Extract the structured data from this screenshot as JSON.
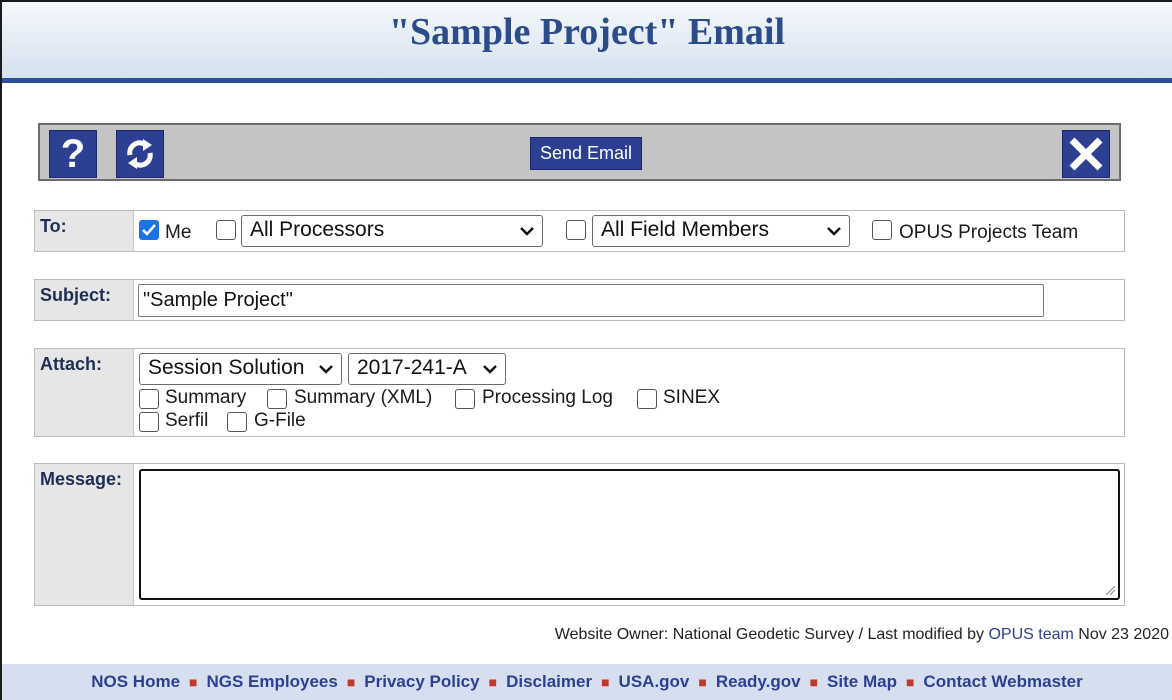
{
  "header": {
    "title": "\"Sample Project\" Email"
  },
  "toolbar": {
    "help_icon": "help-icon",
    "refresh_icon": "refresh-icon",
    "send_label": "Send Email",
    "close_icon": "close-icon"
  },
  "to": {
    "label": "To:",
    "me_label": "Me",
    "me_checked": true,
    "processors_checked": false,
    "processors_select": "All Processors",
    "field_members_checked": false,
    "field_members_select": "All Field Members",
    "opus_team_checked": false,
    "opus_team_label": "OPUS Projects Team"
  },
  "subject": {
    "label": "Subject:",
    "value": "\"Sample Project\""
  },
  "attach": {
    "label": "Attach:",
    "solution_select": "Session Solution",
    "session_select": "2017-241-A",
    "options": [
      {
        "label": "Summary",
        "checked": false
      },
      {
        "label": "Summary (XML)",
        "checked": false
      },
      {
        "label": "Processing Log",
        "checked": false
      },
      {
        "label": "SINEX",
        "checked": false
      },
      {
        "label": "Serfil",
        "checked": false
      },
      {
        "label": "G-File",
        "checked": false
      }
    ]
  },
  "message": {
    "label": "Message:",
    "value": ""
  },
  "footer": {
    "owner_prefix": "Website Owner: National Geodetic Survey  /  Last modified by ",
    "owner_link": "OPUS team",
    "owner_date": " Nov 23 2020",
    "links": [
      "NOS Home",
      "NGS Employees",
      "Privacy Policy",
      "Disclaimer",
      "USA.gov",
      "Ready.gov",
      "Site Map",
      "Contact Webmaster"
    ]
  },
  "colors": {
    "accent": "#2d3f91",
    "separator": "#c0392b",
    "checkbox_checked": "#1a73e8"
  }
}
